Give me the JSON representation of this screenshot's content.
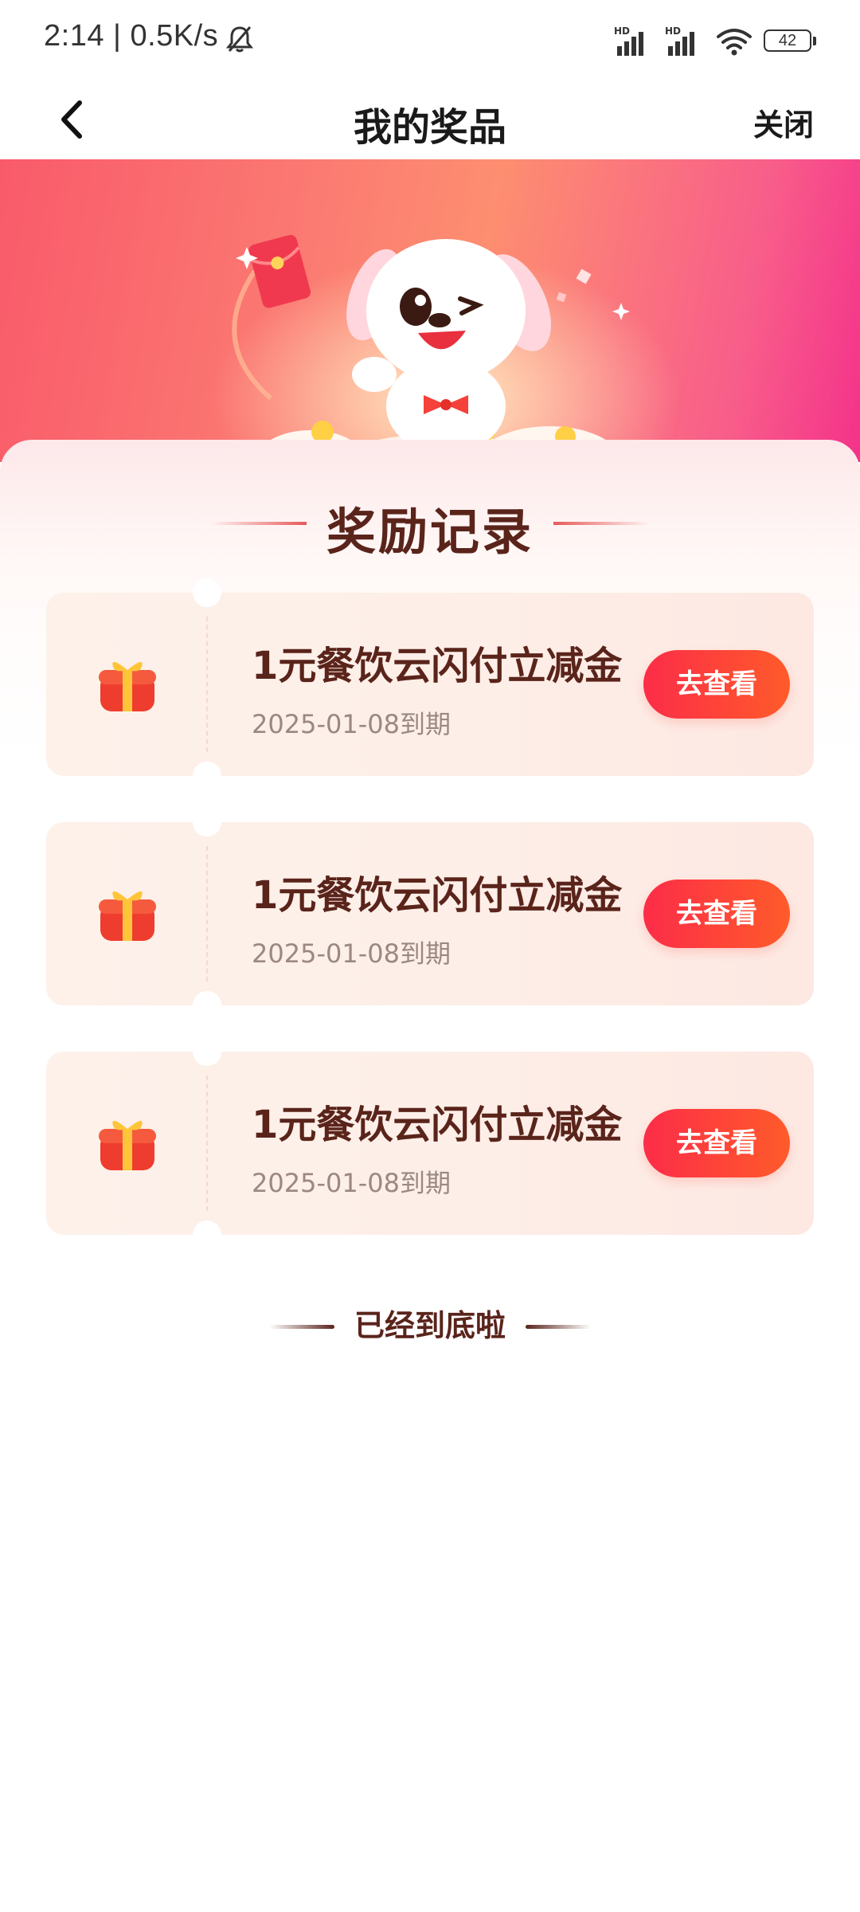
{
  "status_bar": {
    "time_speed": "2:14 | 0.5K/s",
    "bell_icon": "bell-muted-icon",
    "signal_label_1": "HD",
    "signal_label_2": "HD",
    "battery_level": "42"
  },
  "nav": {
    "back_icon": "chevron-left-icon",
    "title": "我的奖品",
    "close_label": "关闭"
  },
  "banner": {
    "illustration": "mascot-dog-with-red-envelope"
  },
  "section": {
    "title": "奖励记录"
  },
  "coupons": [
    {
      "name": "1元餐饮云闪付立减金",
      "expiry": "2025-01-08到期",
      "button_label": "去查看",
      "icon": "gift-box-icon"
    },
    {
      "name": "1元餐饮云闪付立减金",
      "expiry": "2025-01-08到期",
      "button_label": "去查看",
      "icon": "gift-box-icon"
    },
    {
      "name": "1元餐饮云闪付立减金",
      "expiry": "2025-01-08到期",
      "button_label": "去查看",
      "icon": "gift-box-icon"
    }
  ],
  "footer": {
    "end_text": "已经到底啦"
  },
  "colors": {
    "accent_red": "#fc2c48",
    "accent_orange": "#ff5b2a",
    "title_brown": "#5a241b",
    "muted_text": "#9b8880"
  }
}
